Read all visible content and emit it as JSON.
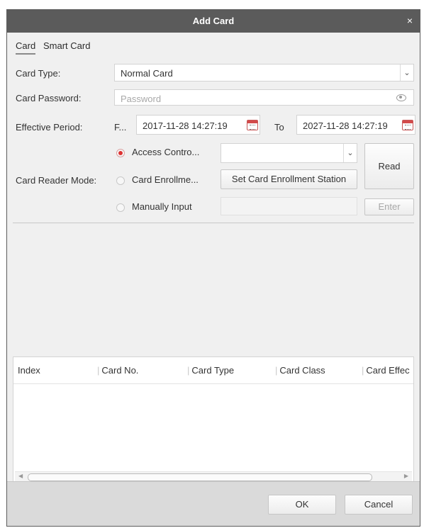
{
  "dialog": {
    "title": "Add Card",
    "close_glyph": "×"
  },
  "tabs": [
    {
      "label": "Card"
    },
    {
      "label": "Smart Card"
    }
  ],
  "card_type": {
    "label": "Card Type:",
    "value": "Normal Card"
  },
  "card_password": {
    "label": "Card Password:",
    "placeholder": "Password"
  },
  "effective_period": {
    "label": "Effective Period:",
    "from_label": "F...",
    "from_value": "2017-11-28 14:27:19",
    "to_label": "To",
    "to_value": "2027-11-28 14:27:19"
  },
  "reader_mode": {
    "label": "Card Reader Mode:",
    "options": [
      {
        "label": "Access Contro...",
        "selected": true
      },
      {
        "label": "Card Enrollme...",
        "selected": false
      },
      {
        "label": "Manually Input",
        "selected": false
      }
    ],
    "access_controller_value": "",
    "enrollment_station_button": "Set Card Enrollment Station",
    "read_button": "Read",
    "enter_button": "Enter",
    "manual_input_value": ""
  },
  "table": {
    "columns": [
      "Index",
      "Card No.",
      "Card Type",
      "Card Class",
      "Card Effec"
    ]
  },
  "footer": {
    "ok_button": "OK",
    "cancel_button": "Cancel"
  },
  "icons": {
    "close": "close-icon",
    "dropdown": "chevron-down-icon",
    "calendar": "calendar-icon",
    "eye": "eye-icon"
  },
  "colors": {
    "titlebar": "#5b5b5b",
    "radio_selected": "#dd3333",
    "calendar": "#d24a4a"
  }
}
